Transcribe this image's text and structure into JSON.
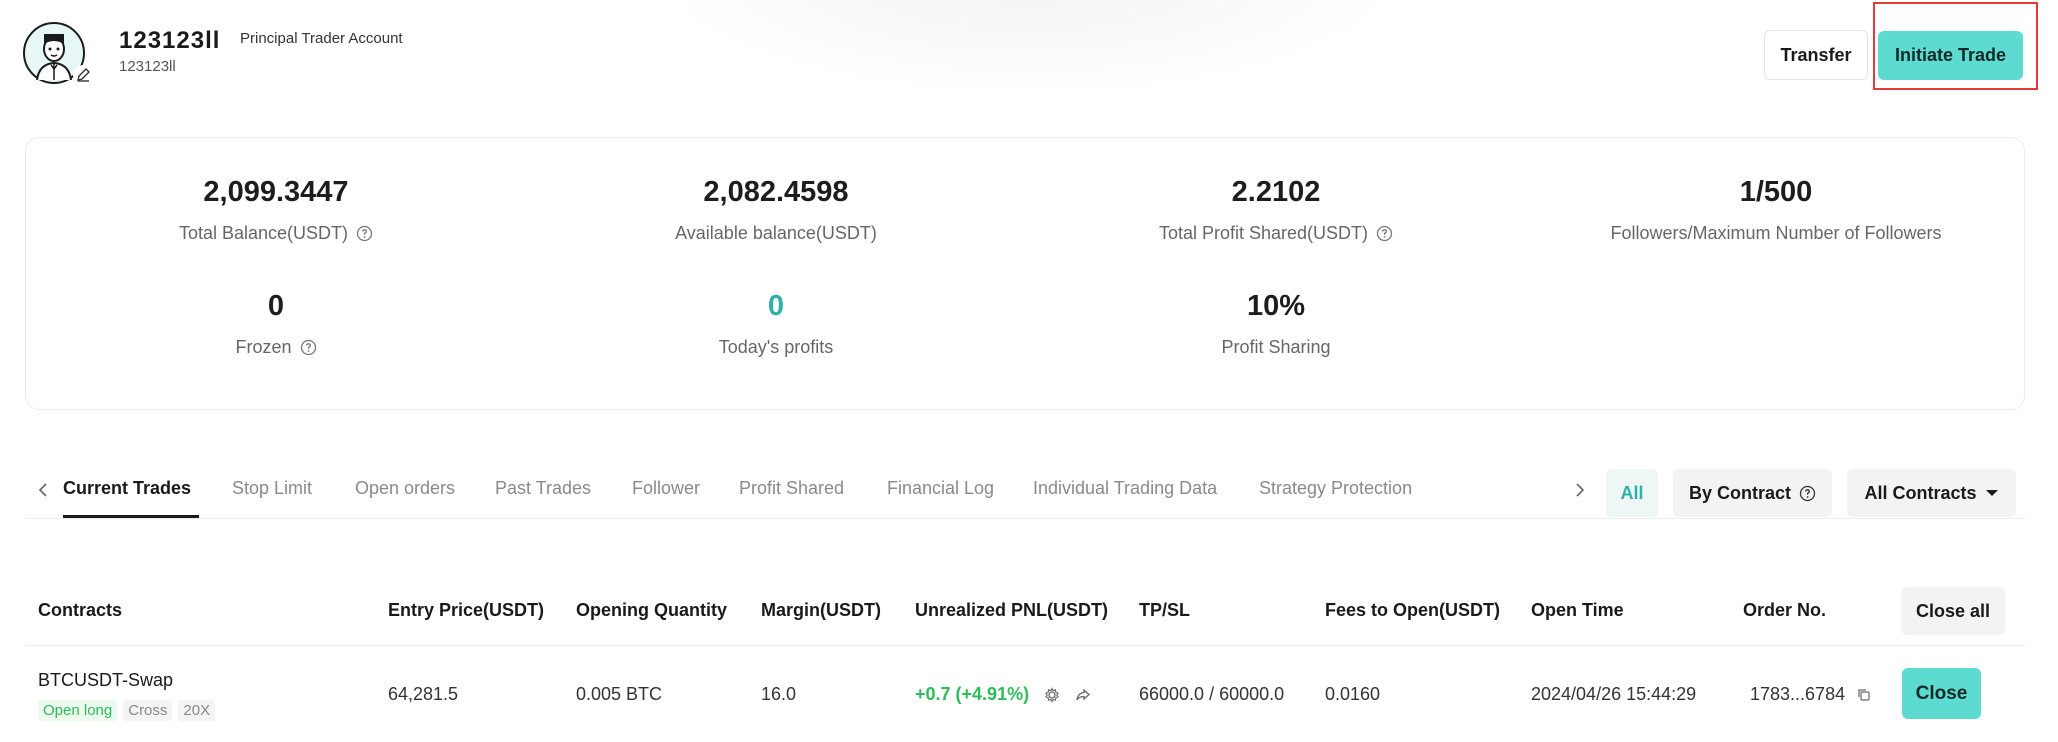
{
  "header": {
    "user_name": "123123ll",
    "user_id": "123123ll",
    "account_type": "Principal Trader Account",
    "transfer_label": "Transfer",
    "initiate_label": "Initiate Trade"
  },
  "stats": [
    {
      "value": "2,099.3447",
      "label": "Total Balance(USDT)",
      "info": true
    },
    {
      "value": "2,082.4598",
      "label": "Available balance(USDT)",
      "info": false
    },
    {
      "value": "2.2102",
      "label": "Total Profit Shared(USDT)",
      "info": true
    },
    {
      "value": "1/500",
      "label": "Followers/Maximum Number of Followers",
      "info": false
    },
    {
      "value": "0",
      "label": "Frozen",
      "info": true
    },
    {
      "value": "0",
      "label": "Today's profits",
      "info": false
    },
    {
      "value": "10%",
      "label": "Profit Sharing",
      "info": false
    }
  ],
  "tabs": [
    {
      "label": "Current Trades",
      "active": true
    },
    {
      "label": "Stop Limit"
    },
    {
      "label": "Open orders"
    },
    {
      "label": "Past Trades"
    },
    {
      "label": "Follower"
    },
    {
      "label": "Profit Shared"
    },
    {
      "label": "Financial Log"
    },
    {
      "label": "Individual Trading Data"
    },
    {
      "label": "Strategy Protection"
    }
  ],
  "filters": {
    "all": "All",
    "by_contract": "By Contract",
    "all_contracts": "All Contracts"
  },
  "table": {
    "headers": [
      "Contracts",
      "Entry Price(USDT)",
      "Opening Quantity",
      "Margin(USDT)",
      "Unrealized PNL(USDT)",
      "TP/SL",
      "Fees to Open(USDT)",
      "Open Time",
      "Order No."
    ],
    "close_all_label": "Close all",
    "rows": [
      {
        "contract": "BTCUSDT-Swap",
        "tags": [
          "Open long",
          "Cross",
          "20X"
        ],
        "entry_price": "64,281.5",
        "quantity": "0.005 BTC",
        "margin": "16.0",
        "pnl": "+0.7 (+4.91%)",
        "tpsl": "66000.0 / 60000.0",
        "fees": "0.0160",
        "open_time": "2024/04/26 15:44:29",
        "order_no": "1783...6784",
        "close_label": "Close"
      }
    ]
  },
  "colors": {
    "accent": "#5edbd0",
    "teal_text": "#2db2a8",
    "profit_green": "#2ebd5a",
    "highlight_red": "#e23b3b"
  }
}
